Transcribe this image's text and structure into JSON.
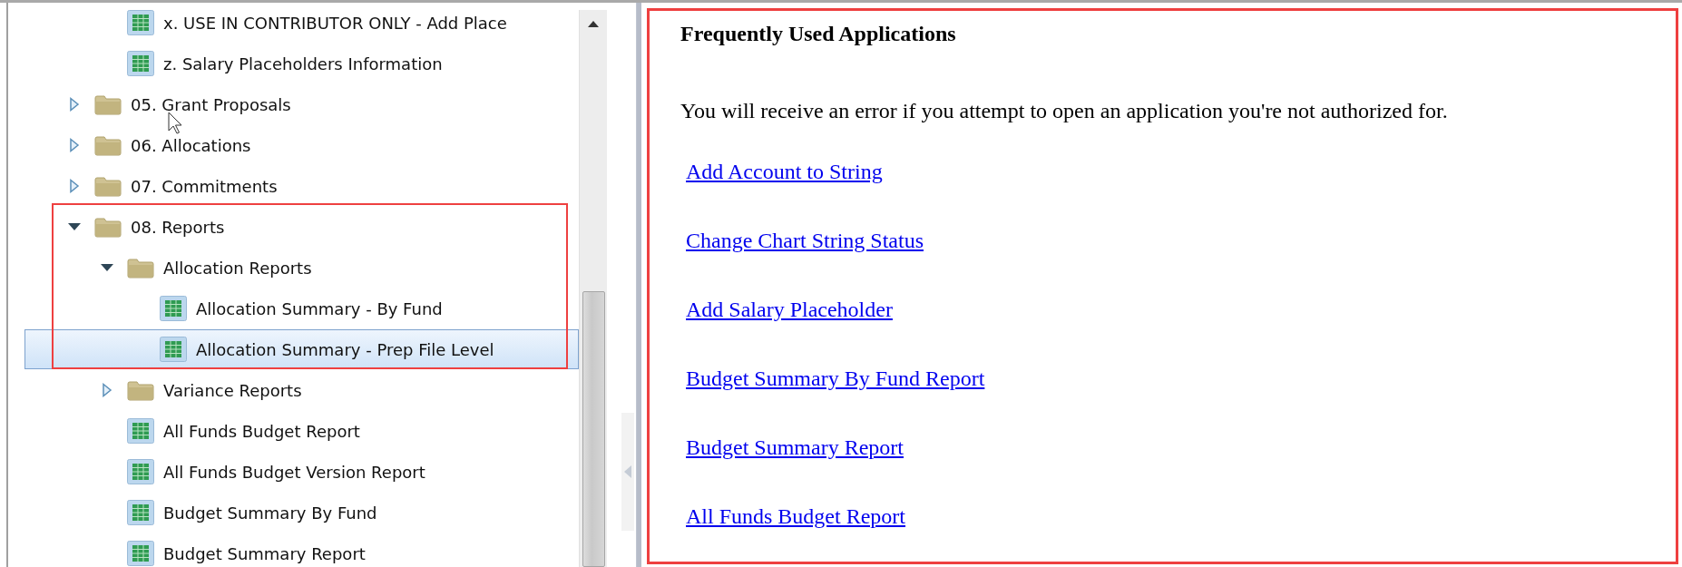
{
  "tree": [
    {
      "children": [
        {
          "label": "x. USE IN CONTRIBUTOR ONLY - Add Place",
          "kind": "report",
          "selected": false,
          "annotated": false
        },
        {
          "label": "z. Salary Placeholders Information",
          "kind": "report",
          "selected": false,
          "annotated": false
        }
      ]
    },
    {
      "label": "05. Grant Proposals",
      "kind": "folder",
      "expanded": false,
      "selected": false,
      "annotated": false
    },
    {
      "label": "06. Allocations",
      "kind": "folder",
      "expanded": false,
      "selected": false,
      "annotated": false
    },
    {
      "label": "07. Commitments",
      "kind": "folder",
      "expanded": false,
      "selected": false,
      "annotated": false
    },
    {
      "label": "08. Reports",
      "kind": "folder",
      "expanded": true,
      "selected": false,
      "annotated": true,
      "children": [
        {
          "label": "Allocation Reports",
          "kind": "folder",
          "expanded": true,
          "selected": false,
          "annotated": true,
          "children": [
            {
              "label": "Allocation Summary - By Fund",
              "kind": "report",
              "selected": false,
              "annotated": true
            },
            {
              "label": "Allocation Summary - Prep File Level",
              "kind": "report",
              "selected": true,
              "annotated": true
            }
          ]
        },
        {
          "label": "Variance Reports",
          "kind": "folder",
          "expanded": false,
          "selected": false,
          "annotated": false
        },
        {
          "label": "All Funds Budget Report",
          "kind": "report",
          "selected": false,
          "annotated": false
        },
        {
          "label": "All Funds Budget Version Report",
          "kind": "report",
          "selected": false,
          "annotated": false
        },
        {
          "label": "Budget Summary By Fund",
          "kind": "report",
          "selected": false,
          "annotated": false
        },
        {
          "label": "Budget Summary Report",
          "kind": "report",
          "selected": false,
          "annotated": false
        }
      ]
    }
  ],
  "panel": {
    "annotated": true,
    "title": "Frequently Used Applications",
    "notice": "You will receive an error if you attempt to open an application you're not authorized for.",
    "links": [
      "Add Account to String",
      "Change Chart String Status",
      "Add Salary Placeholder",
      "Budget Summary By Fund Report",
      "Budget Summary Report",
      "All Funds Budget Report"
    ]
  }
}
